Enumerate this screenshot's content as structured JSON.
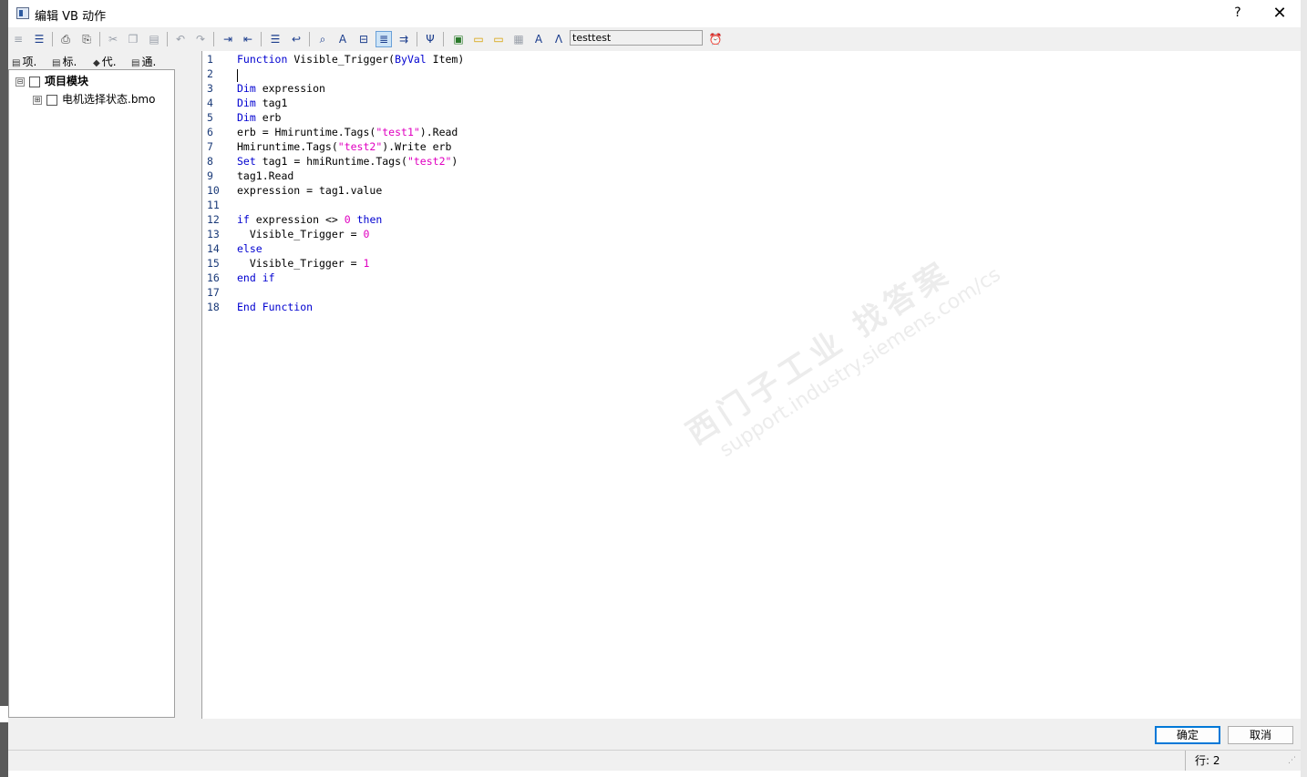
{
  "window": {
    "title": "编辑 VB 动作",
    "help_label": "?",
    "close_label": "✕"
  },
  "toolbar": {
    "tag_value": "testtest",
    "icons": [
      "menu-icon",
      "align-left-icon",
      "print-icon",
      "print-preview-icon",
      "cut-icon",
      "copy-icon",
      "paste-icon",
      "undo-icon",
      "redo-icon",
      "indent-icon",
      "outdent-icon",
      "align-right-icon",
      "wrap-icon",
      "find-icon",
      "replace-icon",
      "bookmark-icon",
      "toggle-bookmark-icon",
      "next-bookmark-icon",
      "syntax-check-icon",
      "add-file-icon",
      "open-folder-icon",
      "new-folder-icon",
      "module-icon",
      "font-icon",
      "compile-icon",
      "trigger-clock-icon"
    ]
  },
  "left_panel": {
    "tabs": [
      {
        "label": "项."
      },
      {
        "label": "标."
      },
      {
        "label": "代."
      },
      {
        "label": "通."
      }
    ],
    "tree": {
      "root": {
        "label": "项目模块",
        "expander": "⊟"
      },
      "child": {
        "label": "电机选择状态.bmo",
        "expander": "⊞"
      }
    }
  },
  "editor": {
    "lines": [
      {
        "n": "1",
        "parts": [
          [
            "kw",
            "Function"
          ],
          [
            "t",
            " Visible_Trigger("
          ],
          [
            "kw",
            "ByVal"
          ],
          [
            "t",
            " Item)"
          ]
        ]
      },
      {
        "n": "2",
        "parts": []
      },
      {
        "n": "3",
        "parts": [
          [
            "kw",
            "Dim"
          ],
          [
            "t",
            " expression"
          ]
        ]
      },
      {
        "n": "4",
        "parts": [
          [
            "kw",
            "Dim"
          ],
          [
            "t",
            " tag1"
          ]
        ]
      },
      {
        "n": "5",
        "parts": [
          [
            "kw",
            "Dim"
          ],
          [
            "t",
            " erb"
          ]
        ]
      },
      {
        "n": "6",
        "parts": [
          [
            "t",
            "erb = Hmiruntime.Tags("
          ],
          [
            "str",
            "\"test1\""
          ],
          [
            "t",
            ").Read"
          ]
        ]
      },
      {
        "n": "7",
        "parts": [
          [
            "t",
            "Hmiruntime.Tags("
          ],
          [
            "str",
            "\"test2\""
          ],
          [
            "t",
            ").Write erb"
          ]
        ]
      },
      {
        "n": "8",
        "parts": [
          [
            "kw",
            "Set"
          ],
          [
            "t",
            " tag1 = hmiRuntime.Tags("
          ],
          [
            "str",
            "\"test2\""
          ],
          [
            "t",
            ")"
          ]
        ]
      },
      {
        "n": "9",
        "parts": [
          [
            "t",
            "tag1.Read"
          ]
        ]
      },
      {
        "n": "10",
        "parts": [
          [
            "t",
            "expression = tag1.value"
          ]
        ]
      },
      {
        "n": "11",
        "parts": []
      },
      {
        "n": "12",
        "parts": [
          [
            "kw",
            "if"
          ],
          [
            "t",
            " expression <> "
          ],
          [
            "num",
            "0"
          ],
          [
            "t",
            " "
          ],
          [
            "kw",
            "then"
          ]
        ]
      },
      {
        "n": "13",
        "parts": [
          [
            "t",
            "  Visible_Trigger = "
          ],
          [
            "num",
            "0"
          ]
        ]
      },
      {
        "n": "14",
        "parts": [
          [
            "kw",
            "else"
          ]
        ]
      },
      {
        "n": "15",
        "parts": [
          [
            "t",
            "  Visible_Trigger = "
          ],
          [
            "num",
            "1"
          ]
        ]
      },
      {
        "n": "16",
        "parts": [
          [
            "kw",
            "end if"
          ]
        ]
      },
      {
        "n": "17",
        "parts": []
      },
      {
        "n": "18",
        "parts": [
          [
            "kw",
            "End Function"
          ]
        ]
      }
    ],
    "watermark": {
      "line1": "西门子工业 找答案",
      "line2": "support.industry.siemens.com/cs"
    }
  },
  "buttons": {
    "ok": "确定",
    "cancel": "取消"
  },
  "status": {
    "position": "行:  2"
  }
}
